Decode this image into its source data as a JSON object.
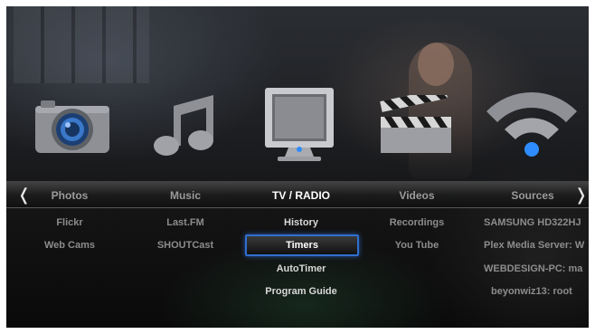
{
  "menu": {
    "categories": [
      "Photos",
      "Music",
      "TV / RADIO",
      "Videos",
      "Sources"
    ],
    "left_arrow": "❬",
    "right_arrow": "❭"
  },
  "submenus": {
    "photos": [
      "Flickr",
      "Web Cams"
    ],
    "music": [
      "Last.FM",
      "SHOUTCast"
    ],
    "tv_radio": [
      "History",
      "Timers",
      "AutoTimer",
      "Program Guide"
    ],
    "videos": [
      "Recordings",
      "You Tube"
    ],
    "sources": [
      "SAMSUNG HD322HJ",
      "Plex Media Server: W",
      "WEBDESIGN-PC: ma",
      "beyonwiz13: root"
    ]
  },
  "icons": [
    "camera-icon",
    "music-note-icon",
    "tv-monitor-icon",
    "clapperboard-icon",
    "wifi-icon"
  ],
  "colors": {
    "accent": "#2f6fd0",
    "active_text": "#ffffff",
    "dim_text": "#8c8c8c"
  }
}
